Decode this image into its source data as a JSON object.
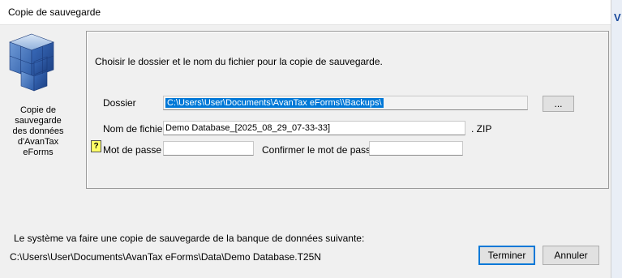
{
  "window": {
    "title": "Copie de sauvegarde",
    "edge_glyph": "V"
  },
  "sidebar": {
    "caption": "Copie de sauvegarde des données d'AvanTax eForms"
  },
  "panel": {
    "instruction": "Choisir le dossier et le nom du fichier pour la copie de sauvegarde.",
    "folder_label": "Dossier",
    "folder_value": "C:\\Users\\User\\Documents\\AvanTax eForms\\\\Backups\\",
    "browse_label": "...",
    "filename_label": "Nom de fichier",
    "filename_value": "Demo Database_[2025_08_29_07-33-33]",
    "extension": ". ZIP",
    "help_label": "?",
    "password_label": "Mot de passe",
    "password_value": "",
    "confirm_label": "Confirmer le mot de passe",
    "confirm_value": ""
  },
  "footer": {
    "message": "Le système va faire une copie de sauvegarde de la banque de données suivante:",
    "database_path": "C:\\Users\\User\\Documents\\AvanTax eForms\\Data\\Demo Database.T25N",
    "finish_label": "Terminer",
    "cancel_label": "Annuler"
  },
  "colors": {
    "selection": "#0078d7",
    "help_bg": "#ffff66",
    "accent_blue": "#1a4a9c"
  },
  "icons": {
    "app": "blue-cubes-icon",
    "help": "help-icon"
  }
}
